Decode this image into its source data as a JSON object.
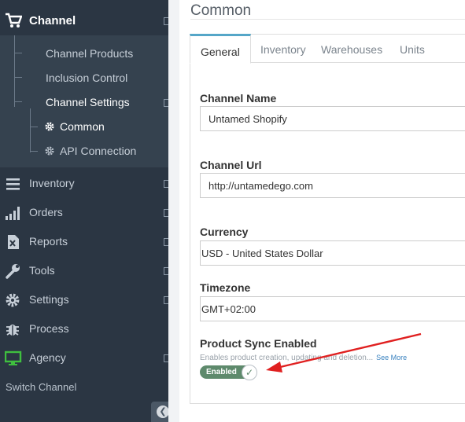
{
  "sidebar": {
    "top_item": {
      "label": "Channel",
      "icon": "cart-icon"
    },
    "submenu": [
      {
        "label": "Channel Products",
        "active": false
      },
      {
        "label": "Inclusion Control",
        "active": false
      },
      {
        "label": "Channel Settings",
        "active": true
      }
    ],
    "subsubmenu": [
      {
        "label": "Common",
        "icon": "gear-icon",
        "active": true
      },
      {
        "label": "API Connection",
        "icon": "gear-icon",
        "active": false
      }
    ],
    "items": [
      {
        "label": "Inventory",
        "icon": "menu-lines-icon"
      },
      {
        "label": "Orders",
        "icon": "signal-bars-icon"
      },
      {
        "label": "Reports",
        "icon": "excel-file-icon"
      },
      {
        "label": "Tools",
        "icon": "wrench-icon"
      },
      {
        "label": "Settings",
        "icon": "gear-icon"
      },
      {
        "label": "Process",
        "icon": "bug-icon"
      },
      {
        "label": "Agency",
        "icon": "monitor-icon"
      }
    ],
    "switch_channel": "Switch Channel",
    "collapse_icon": "chevron-left-icon"
  },
  "page": {
    "title": "Common",
    "tabs": [
      {
        "label": "General",
        "active": true
      },
      {
        "label": "Inventory",
        "active": false
      },
      {
        "label": "Warehouses",
        "active": false
      },
      {
        "label": "Units",
        "active": false
      }
    ]
  },
  "form": {
    "channel_name": {
      "label": "Channel Name",
      "value": "Untamed Shopify"
    },
    "channel_url": {
      "label": "Channel Url",
      "value": "http://untamedego.com"
    },
    "currency": {
      "label": "Currency",
      "value": "USD - United States Dollar"
    },
    "timezone": {
      "label": "Timezone",
      "value": "GMT+02:00"
    },
    "product_sync": {
      "label": "Product Sync Enabled",
      "help": "Enables product creation, updating and deletion...",
      "see_more": "See More",
      "toggle_label": "Enabled",
      "enabled": true
    }
  },
  "colors": {
    "sidebar_bg": "#2b3643",
    "submenu_bg": "#35424f",
    "tab_accent": "#55a6c8",
    "toggle_on": "#5e8a6c",
    "annotation_arrow": "#e02020",
    "agency_icon": "#3fbf3f"
  }
}
